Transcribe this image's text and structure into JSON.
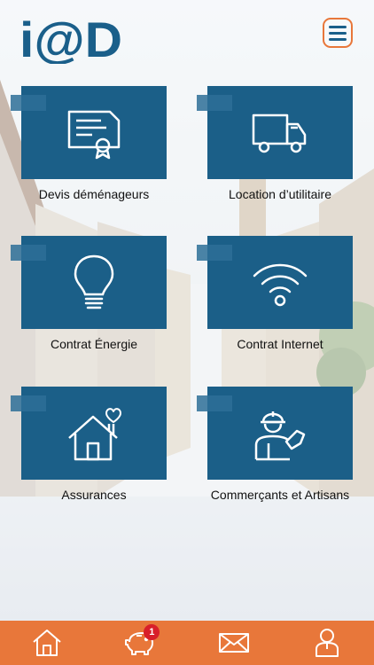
{
  "header": {
    "logo_text": "i@D",
    "menu_icon": "hamburger-menu-icon"
  },
  "tiles": [
    {
      "label": "Devis déménageurs",
      "icon": "certificate-icon"
    },
    {
      "label": "Location d’utilitaire",
      "icon": "truck-icon"
    },
    {
      "label": "Contrat Énergie",
      "icon": "lightbulb-icon"
    },
    {
      "label": "Contrat Internet",
      "icon": "wifi-icon"
    },
    {
      "label": "Assurances",
      "icon": "house-heart-icon"
    },
    {
      "label": "Commerçants et Artisans",
      "icon": "worker-icon"
    }
  ],
  "bottom_nav": {
    "items": [
      {
        "icon": "home-icon"
      },
      {
        "icon": "piggy-bank-icon",
        "badge": "1"
      },
      {
        "icon": "mail-icon"
      },
      {
        "icon": "user-icon"
      }
    ]
  },
  "colors": {
    "tile_blue": "#1b5f88",
    "accent_orange": "#e8773a",
    "badge_red": "#d81f2a"
  }
}
